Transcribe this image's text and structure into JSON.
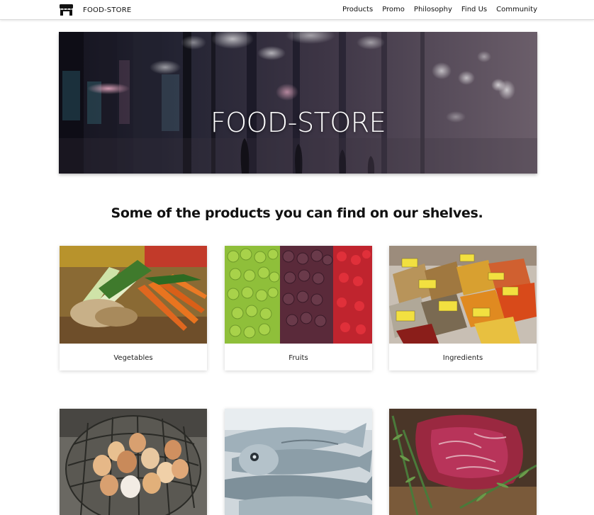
{
  "navbar": {
    "brand": "FOOD-STORE",
    "brand_icon": "store-icon",
    "links": [
      "Products",
      "Promo",
      "Philosophy",
      "Find Us",
      "Community"
    ]
  },
  "hero": {
    "title": "FOOD-STORE"
  },
  "products": {
    "heading": "Some of the products you can find on our shelves.",
    "items": [
      {
        "label": "Vegetables",
        "image": "vegetables-image"
      },
      {
        "label": "Fruits",
        "image": "fruits-image"
      },
      {
        "label": "Ingredients",
        "image": "spices-image"
      },
      {
        "label": "",
        "image": "eggs-image"
      },
      {
        "label": "",
        "image": "fish-image"
      },
      {
        "label": "",
        "image": "meat-image"
      }
    ]
  },
  "colors": {
    "text": "#111111",
    "navbar_bg": "#ffffff",
    "card_bg": "#ffffff"
  }
}
